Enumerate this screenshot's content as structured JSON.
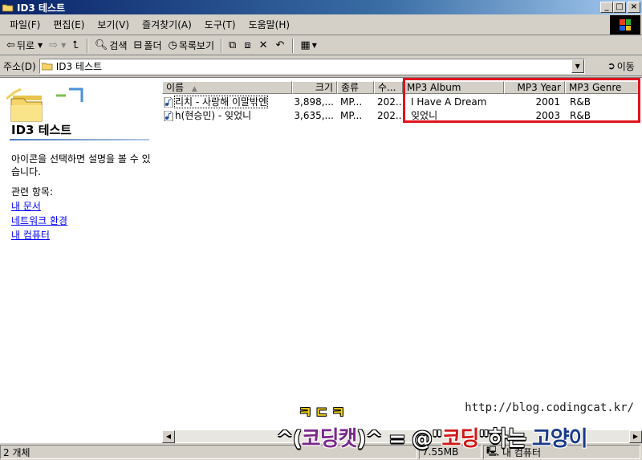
{
  "window": {
    "title": "ID3 테스트",
    "buttons": {
      "minimize": "_",
      "maximize": "□",
      "close": "×"
    }
  },
  "menubar": {
    "items": [
      "파일(F)",
      "편집(E)",
      "보기(V)",
      "즐겨찾기(A)",
      "도구(T)",
      "도움말(H)"
    ]
  },
  "toolbar": {
    "back_label": "뒤로",
    "search_label": "검색",
    "folders_label": "폴더",
    "list_label": "목록보기"
  },
  "addressbar": {
    "label": "주소(D)",
    "value": "ID3 테스트",
    "go_label": "이동"
  },
  "leftpane": {
    "title": "ID3 테스트",
    "description": "아이콘을 선택하면 설명을 볼 수 있습니다.",
    "related_label": "관련 항목:",
    "links": [
      "내 문서",
      "네트워크 환경",
      "내 컴퓨터"
    ]
  },
  "columns": {
    "name": "이름",
    "size": "크기",
    "type": "종류",
    "modified": "수...",
    "album": "MP3 Album",
    "year": "MP3 Year",
    "genre": "MP3 Genre"
  },
  "files": [
    {
      "name": "리치 - 사랑해 이말밖엔",
      "size": "3,898,...",
      "type": "MP...",
      "modified": "202...",
      "album": "I Have A Dream",
      "year": "2001",
      "genre": "R&B"
    },
    {
      "name": "h(현승민) - 잊었니",
      "size": "3,635,...",
      "type": "MP...",
      "modified": "202...",
      "album": "잊었니",
      "year": "2003",
      "genre": "R&B"
    }
  ],
  "statusbar": {
    "count": "2 개체",
    "size": "7.55MB",
    "location": "내 컴퓨터"
  },
  "watermark": {
    "korean_tag": "ㅋㄷㅋ",
    "slogan_a": "^(",
    "slogan_b": "코딩캣",
    "slogan_c": ")^ = @\"",
    "slogan_d": "코딩",
    "slogan_e": "\"하는 ",
    "slogan_f": "고양이",
    "url": "http://blog.codingcat.kr/"
  },
  "colors": {
    "highlight_box": "#e0141e",
    "titlebar": "#0a246a",
    "link": "#0000ff"
  }
}
